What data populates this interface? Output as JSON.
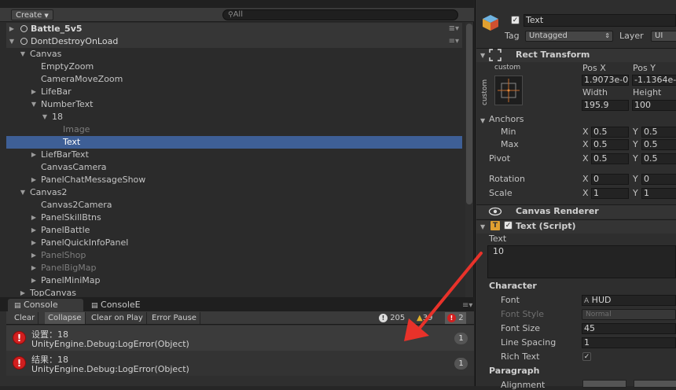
{
  "hierarchy": {
    "create_label": "Create",
    "search_placeholder": "All",
    "scenes": [
      {
        "label": "Battle_5v5"
      },
      {
        "label": "DontDestroyOnLoad"
      }
    ],
    "items": [
      {
        "label": "Canvas"
      },
      {
        "label": "EmptyZoom"
      },
      {
        "label": "CameraMoveZoom"
      },
      {
        "label": "LifeBar"
      },
      {
        "label": "NumberText"
      },
      {
        "label": "18"
      },
      {
        "label": "Image"
      },
      {
        "label": "Text"
      },
      {
        "label": "LiefBarText"
      },
      {
        "label": "CanvasCamera"
      },
      {
        "label": "PanelChatMessageShow"
      },
      {
        "label": "Canvas2"
      },
      {
        "label": "Canvas2Camera"
      },
      {
        "label": "PanelSkillBtns"
      },
      {
        "label": "PanelBattle"
      },
      {
        "label": "PanelQuickInfoPanel"
      },
      {
        "label": "PanelShop"
      },
      {
        "label": "PanelBigMap"
      },
      {
        "label": "PanelMiniMap"
      },
      {
        "label": "TopCanvas"
      }
    ]
  },
  "console": {
    "tabs": [
      "Console",
      "ConsoleE"
    ],
    "buttons": [
      "Clear",
      "Collapse",
      "Clear on Play",
      "Error Pause"
    ],
    "counts": {
      "info": "205",
      "warning": "39",
      "error": "2"
    },
    "logs": [
      {
        "line1": "设置：18",
        "line2": "UnityEngine.Debug:LogError(Object)",
        "count": "1"
      },
      {
        "line1": "结果：18",
        "line2": "UnityEngine.Debug:LogError(Object)",
        "count": "1"
      }
    ]
  },
  "inspector": {
    "object_name": "Text",
    "tag_label": "Tag",
    "tag_value": "Untagged",
    "layer_label": "Layer",
    "layer_value": "UI",
    "rect_transform": {
      "title": "Rect Transform",
      "anchor_preset": "custom",
      "side_label": "custom",
      "pos_x_label": "Pos X",
      "pos_y_label": "Pos Y",
      "pos_x": "1.9073e-0",
      "pos_y": "-1.1364e-",
      "width_label": "Width",
      "height_label": "Height",
      "width": "195.9",
      "height": "100",
      "anchors_label": "Anchors",
      "min_label": "Min",
      "max_label": "Max",
      "pivot_label": "Pivot",
      "rotation_label": "Rotation",
      "scale_label": "Scale",
      "x_label": "X",
      "y_label": "Y",
      "min_x": "0.5",
      "min_y": "0.5",
      "max_x": "0.5",
      "max_y": "0.5",
      "pivot_x": "0.5",
      "pivot_y": "0.5",
      "rot_x": "0",
      "rot_y": "0",
      "scale_x": "1",
      "scale_y": "1"
    },
    "canvas_renderer": {
      "title": "Canvas Renderer"
    },
    "text_script": {
      "title": "Text (Script)",
      "text_label": "Text",
      "text_value": "10",
      "character_label": "Character",
      "font_label": "Font",
      "font_value": "HUD",
      "font_style_label": "Font Style",
      "font_style_value": "Normal",
      "font_size_label": "Font Size",
      "font_size_value": "45",
      "line_spacing_label": "Line Spacing",
      "line_spacing_value": "1",
      "rich_text_label": "Rich Text",
      "paragraph_label": "Paragraph",
      "alignment_label": "Alignment"
    }
  },
  "colors": {
    "selection": "#3e5f96",
    "error": "#d11f1f",
    "annotation_arrow": "#e8322a"
  }
}
